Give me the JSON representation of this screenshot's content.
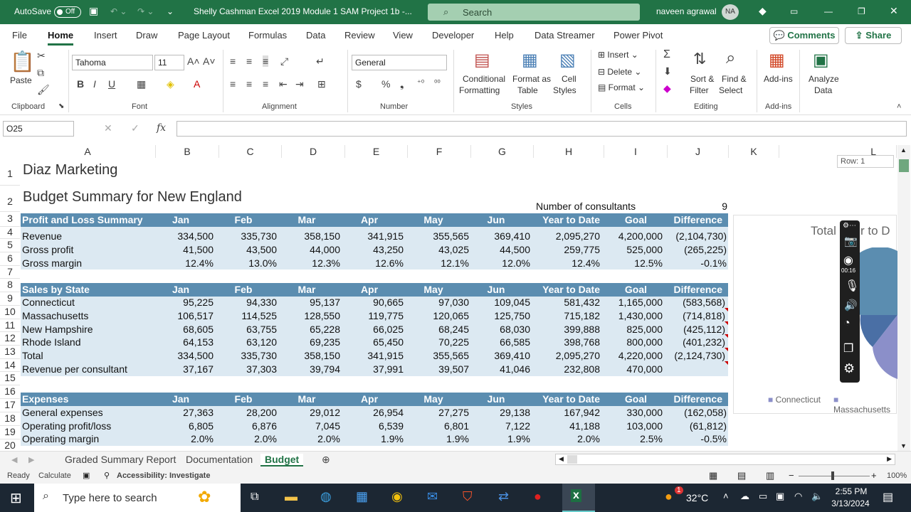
{
  "titlebar": {
    "autosave": "AutoSave",
    "toggle": "Off",
    "filename": "Shelly Cashman Excel 2019  Module 1 SAM Project 1b  -...",
    "search": "Search",
    "user": "naveen agrawal",
    "initials": "NA"
  },
  "menu": {
    "tabs": [
      "File",
      "Home",
      "Insert",
      "Draw",
      "Page Layout",
      "Formulas",
      "Data",
      "Review",
      "View",
      "Developer",
      "Help",
      "Data Streamer",
      "Power Pivot"
    ],
    "comments": "Comments",
    "share": "Share"
  },
  "ribbon": {
    "paste": "Paste",
    "clipboard": "Clipboard",
    "font_name": "Tahoma",
    "font_size": "11",
    "font": "Font",
    "alignment": "Alignment",
    "number_format": "General",
    "number": "Number",
    "cond1": "Conditional",
    "cond2": "Formatting",
    "fat1": "Format as",
    "fat2": "Table",
    "cs1": "Cell",
    "cs2": "Styles",
    "styles": "Styles",
    "insert": "Insert",
    "delete": "Delete",
    "format": "Format",
    "cells": "Cells",
    "sort1": "Sort &",
    "sort2": "Filter",
    "find1": "Find &",
    "find2": "Select",
    "editing": "Editing",
    "addins": "Add-ins",
    "addins_grp": "Add-ins",
    "analyze1": "Analyze",
    "analyze2": "Data"
  },
  "formula_bar": {
    "namebox": "O25",
    "fx": "fx",
    "value": ""
  },
  "columns": [
    "A",
    "B",
    "C",
    "D",
    "E",
    "F",
    "G",
    "H",
    "I",
    "J",
    "K",
    "L"
  ],
  "tooltip": "Row: 1",
  "sheet": {
    "title": "Diaz Marketing",
    "subtitle": "Budget Summary for New England",
    "consultants_label": "Number of consultants",
    "consultants": "9",
    "headers": [
      "Jan",
      "Feb",
      "Mar",
      "Apr",
      "May",
      "Jun",
      "Year to Date",
      "Goal",
      "Difference"
    ],
    "pl_title": "Profit and Loss Summary",
    "pl_rows": [
      {
        "label": "Revenue",
        "vals": [
          "334,500",
          "335,730",
          "358,150",
          "341,915",
          "355,565",
          "369,410",
          "2,095,270",
          "4,200,000",
          "(2,104,730)"
        ]
      },
      {
        "label": "Gross profit",
        "vals": [
          "41,500",
          "43,500",
          "44,000",
          "43,250",
          "43,025",
          "44,500",
          "259,775",
          "525,000",
          "(265,225)"
        ]
      },
      {
        "label": "Gross margin",
        "vals": [
          "12.4%",
          "13.0%",
          "12.3%",
          "12.6%",
          "12.1%",
          "12.0%",
          "12.4%",
          "12.5%",
          "-0.1%"
        ]
      }
    ],
    "sales_title": "Sales by State",
    "sales_rows": [
      {
        "label": "Connecticut",
        "vals": [
          "95,225",
          "94,330",
          "95,137",
          "90,665",
          "97,030",
          "109,045",
          "581,432",
          "1,165,000",
          "(583,568)"
        ]
      },
      {
        "label": "Massachusetts",
        "vals": [
          "106,517",
          "114,525",
          "128,550",
          "119,775",
          "120,065",
          "125,750",
          "715,182",
          "1,430,000",
          "(714,818)"
        ]
      },
      {
        "label": "New Hampshire",
        "vals": [
          "68,605",
          "63,755",
          "65,228",
          "66,025",
          "68,245",
          "68,030",
          "399,888",
          "825,000",
          "(425,112)"
        ]
      },
      {
        "label": "Rhode Island",
        "vals": [
          "64,153",
          "63,120",
          "69,235",
          "65,450",
          "70,225",
          "66,585",
          "398,768",
          "800,000",
          "(401,232)"
        ]
      },
      {
        "label": "Total",
        "vals": [
          "334,500",
          "335,730",
          "358,150",
          "341,915",
          "355,565",
          "369,410",
          "2,095,270",
          "4,220,000",
          "(2,124,730)"
        ]
      },
      {
        "label": "Revenue per consultant",
        "vals": [
          "37,167",
          "37,303",
          "39,794",
          "37,991",
          "39,507",
          "41,046",
          "232,808",
          "470,000",
          ""
        ]
      }
    ],
    "exp_title": "Expenses",
    "exp_rows": [
      {
        "label": "General expenses",
        "vals": [
          "27,363",
          "28,200",
          "29,012",
          "26,954",
          "27,275",
          "29,138",
          "167,942",
          "330,000",
          "(162,058)"
        ]
      },
      {
        "label": "Operating profit/loss",
        "vals": [
          "6,805",
          "6,876",
          "7,045",
          "6,539",
          "6,801",
          "7,122",
          "41,188",
          "103,000",
          "(61,812)"
        ]
      },
      {
        "label": "Operating margin",
        "vals": [
          "2.0%",
          "2.0%",
          "2.0%",
          "1.9%",
          "1.9%",
          "1.9%",
          "2.0%",
          "2.5%",
          "-0.5%"
        ]
      }
    ]
  },
  "row_numbers": [
    "1",
    "2",
    "3",
    "4",
    "5",
    "6",
    "7",
    "8",
    "9",
    "10",
    "11",
    "12",
    "13",
    "14",
    "15",
    "16",
    "17",
    "18",
    "19",
    "20"
  ],
  "chart": {
    "title_left": "Total",
    "title_right": "r to D",
    "legend": [
      "Connecticut",
      "Massachusetts"
    ],
    "colors": [
      "#5b8db0",
      "#4a6fa5",
      "#8b8fc9"
    ]
  },
  "recorder": {
    "time": "00:16"
  },
  "sheets": {
    "tabs": [
      "Graded Summary Report",
      "Documentation",
      "Budget"
    ],
    "active": "Budget"
  },
  "status": {
    "ready": "Ready",
    "calculate": "Calculate",
    "accessibility": "Accessibility: Investigate",
    "zoom": "100%"
  },
  "taskbar": {
    "search": "Type here to search",
    "temp": "32°C",
    "time": "2:55 PM",
    "date": "3/13/2024",
    "badge": "1"
  }
}
